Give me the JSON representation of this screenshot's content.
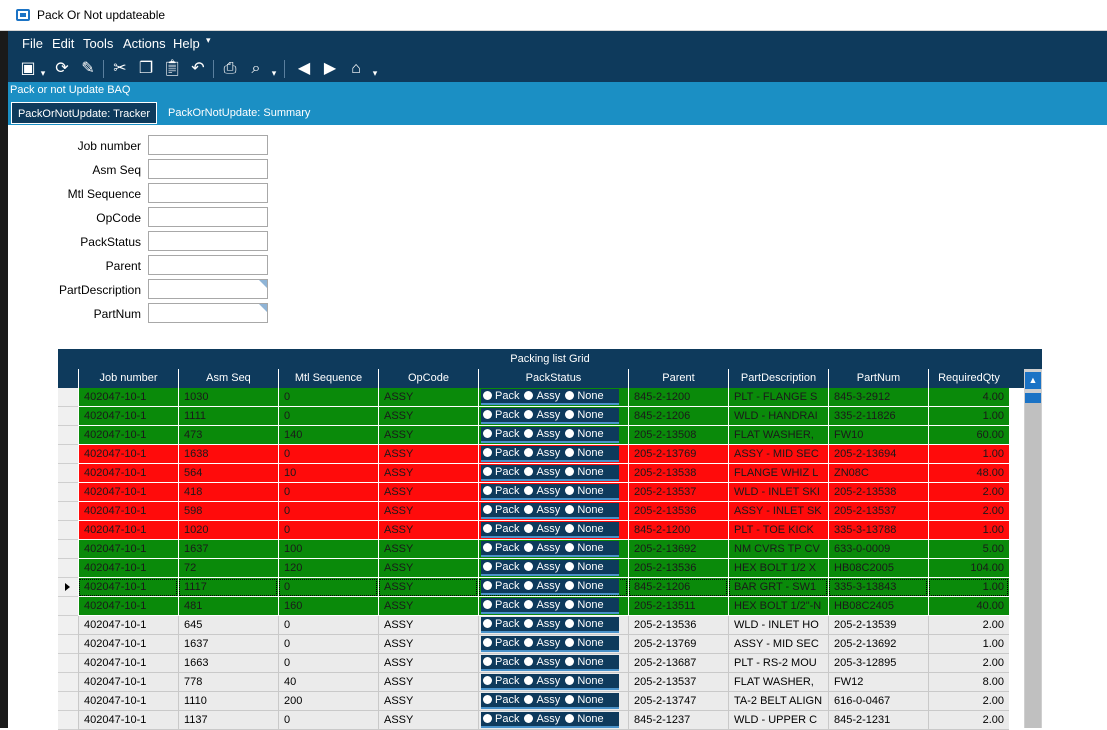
{
  "window": {
    "title": "Pack Or Not updateable"
  },
  "menu": {
    "items": [
      "File",
      "Edit",
      "Tools",
      "Actions",
      "Help"
    ]
  },
  "toolbar": {
    "icons": [
      "save-icon",
      "dropdown-icon",
      "refresh-icon",
      "clear-icon",
      "cut-icon",
      "copy-icon",
      "paste-icon",
      "undo-icon",
      "print-icon",
      "print-preview-icon",
      "dropdown-icon",
      "back-icon",
      "forward-icon",
      "home-icon",
      "dropdown-icon"
    ]
  },
  "baq_bar": {
    "label": "Pack or not Update BAQ"
  },
  "tabs": [
    {
      "label": "PackOrNotUpdate: Tracker",
      "active": true
    },
    {
      "label": "PackOrNotUpdate: Summary",
      "active": false
    }
  ],
  "form": {
    "fields": [
      {
        "label": "Job number",
        "value": ""
      },
      {
        "label": "Asm Seq",
        "value": ""
      },
      {
        "label": "Mtl Sequence",
        "value": ""
      },
      {
        "label": "OpCode",
        "value": ""
      },
      {
        "label": "PackStatus",
        "value": ""
      },
      {
        "label": "Parent",
        "value": ""
      },
      {
        "label": "PartDescription",
        "value": ""
      },
      {
        "label": "PartNum",
        "value": ""
      }
    ]
  },
  "grid": {
    "title": "Packing list Grid",
    "columns": [
      "Job number",
      "Asm Seq",
      "Mtl Sequence",
      "OpCode",
      "PackStatus",
      "Parent",
      "PartDescription",
      "PartNum",
      "RequiredQty"
    ],
    "radio_labels": [
      "Pack",
      "Assy",
      "None"
    ],
    "colors": {
      "green": "#0a8a0a",
      "red": "#ff0b0b",
      "grey": "#ebebeb",
      "header": "#0e3a5c"
    },
    "rows": [
      {
        "job": "402047-10-1",
        "asm": "1030",
        "mtl": "0",
        "op": "ASSY",
        "parent": "845-2-1200",
        "desc": "PLT - FLANGE S",
        "part": "845-3-2912",
        "qty": "4.00",
        "color": "green",
        "selected": false
      },
      {
        "job": "402047-10-1",
        "asm": "1111",
        "mtl": "0",
        "op": "ASSY",
        "parent": "845-2-1206",
        "desc": "WLD - HANDRAI",
        "part": "335-2-11826",
        "qty": "1.00",
        "color": "green",
        "selected": false
      },
      {
        "job": "402047-10-1",
        "asm": "473",
        "mtl": "140",
        "op": "ASSY",
        "parent": "205-2-13508",
        "desc": "FLAT WASHER,",
        "part": "FW10",
        "qty": "60.00",
        "color": "green",
        "selected": false
      },
      {
        "job": "402047-10-1",
        "asm": "1638",
        "mtl": "0",
        "op": "ASSY",
        "parent": "205-2-13769",
        "desc": "ASSY - MID SEC",
        "part": "205-2-13694",
        "qty": "1.00",
        "color": "red",
        "selected": false
      },
      {
        "job": "402047-10-1",
        "asm": "564",
        "mtl": "10",
        "op": "ASSY",
        "parent": "205-2-13538",
        "desc": "FLANGE WHIZ L",
        "part": "ZN08C",
        "qty": "48.00",
        "color": "red",
        "selected": false
      },
      {
        "job": "402047-10-1",
        "asm": "418",
        "mtl": "0",
        "op": "ASSY",
        "parent": "205-2-13537",
        "desc": "WLD - INLET SKI",
        "part": "205-2-13538",
        "qty": "2.00",
        "color": "red",
        "selected": false
      },
      {
        "job": "402047-10-1",
        "asm": "598",
        "mtl": "0",
        "op": "ASSY",
        "parent": "205-2-13536",
        "desc": "ASSY - INLET SK",
        "part": "205-2-13537",
        "qty": "2.00",
        "color": "red",
        "selected": false
      },
      {
        "job": "402047-10-1",
        "asm": "1020",
        "mtl": "0",
        "op": "ASSY",
        "parent": "845-2-1200",
        "desc": "PLT - TOE KICK",
        "part": "335-3-13788",
        "qty": "1.00",
        "color": "red",
        "selected": false
      },
      {
        "job": "402047-10-1",
        "asm": "1637",
        "mtl": "100",
        "op": "ASSY",
        "parent": "205-2-13692",
        "desc": "NM CVRS TP CV",
        "part": "633-0-0009",
        "qty": "5.00",
        "color": "green",
        "selected": false
      },
      {
        "job": "402047-10-1",
        "asm": "72",
        "mtl": "120",
        "op": "ASSY",
        "parent": "205-2-13536",
        "desc": "HEX BOLT 1/2 X",
        "part": "HB08C2005",
        "qty": "104.00",
        "color": "green",
        "selected": false
      },
      {
        "job": "402047-10-1",
        "asm": "1117",
        "mtl": "0",
        "op": "ASSY",
        "parent": "845-2-1206",
        "desc": "BAR GRT - SW1",
        "part": "335-3-13843",
        "qty": "1.00",
        "color": "green",
        "selected": true
      },
      {
        "job": "402047-10-1",
        "asm": "481",
        "mtl": "160",
        "op": "ASSY",
        "parent": "205-2-13511",
        "desc": "HEX BOLT 1/2\"-N",
        "part": "HB08C2405",
        "qty": "40.00",
        "color": "green",
        "selected": false
      },
      {
        "job": "402047-10-1",
        "asm": "645",
        "mtl": "0",
        "op": "ASSY",
        "parent": "205-2-13536",
        "desc": "WLD - INLET HO",
        "part": "205-2-13539",
        "qty": "2.00",
        "color": "grey",
        "selected": false
      },
      {
        "job": "402047-10-1",
        "asm": "1637",
        "mtl": "0",
        "op": "ASSY",
        "parent": "205-2-13769",
        "desc": "ASSY - MID SEC",
        "part": "205-2-13692",
        "qty": "1.00",
        "color": "grey",
        "selected": false
      },
      {
        "job": "402047-10-1",
        "asm": "1663",
        "mtl": "0",
        "op": "ASSY",
        "parent": "205-2-13687",
        "desc": "PLT - RS-2 MOU",
        "part": "205-3-12895",
        "qty": "2.00",
        "color": "grey",
        "selected": false
      },
      {
        "job": "402047-10-1",
        "asm": "778",
        "mtl": "40",
        "op": "ASSY",
        "parent": "205-2-13537",
        "desc": "FLAT WASHER,",
        "part": "FW12",
        "qty": "8.00",
        "color": "grey",
        "selected": false
      },
      {
        "job": "402047-10-1",
        "asm": "1110",
        "mtl": "200",
        "op": "ASSY",
        "parent": "205-2-13747",
        "desc": "TA-2 BELT ALIGN",
        "part": "616-0-0467",
        "qty": "2.00",
        "color": "grey",
        "selected": false
      },
      {
        "job": "402047-10-1",
        "asm": "1137",
        "mtl": "0",
        "op": "ASSY",
        "parent": "845-2-1237",
        "desc": "WLD - UPPER C",
        "part": "845-2-1231",
        "qty": "2.00",
        "color": "grey",
        "selected": false
      }
    ]
  }
}
